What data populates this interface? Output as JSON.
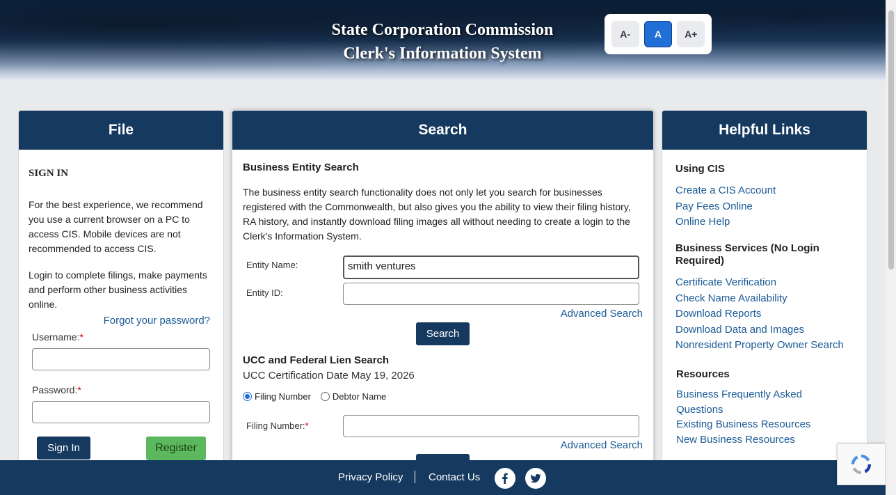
{
  "header": {
    "title_line1": "State Corporation Commission",
    "title_line2": "Clerk's Information System",
    "font_controls": [
      "A-",
      "A",
      "A+"
    ]
  },
  "file_panel": {
    "title": "File",
    "sign_in": "SIGN IN",
    "intro": "For the best experience, we recommend you use a current browser on a PC to access CIS. Mobile devices are not recommended to access CIS.",
    "login_text": "Login to complete filings, make payments and perform other business activities online.",
    "forgot_password": "Forgot your password?",
    "username_label": "Username:",
    "password_label": "Password:",
    "required_mark": "*",
    "sign_in_button": "Sign In",
    "register_button": "Register"
  },
  "search_panel": {
    "title": "Search",
    "business_heading": "Business Entity Search",
    "business_desc": "The business entity search functionality does not only let you search for businesses registered with the Commonwealth, but also gives you the ability to view their filing history, RA history, and instantly download filing images all without needing to create a login to the Clerk's Information System.",
    "entity_name_label": "Entity Name:",
    "entity_name_value": "smith ventures",
    "entity_id_label": "Entity ID:",
    "entity_id_value": "",
    "advanced_search": "Advanced Search",
    "search_button": "Search",
    "ucc_heading": "UCC and Federal Lien Search",
    "ucc_cert_date": "UCC Certification Date May 19, 2026",
    "radio_filing": "Filing Number",
    "radio_debtor": "Debtor Name",
    "filing_number_label": "Filing Number:",
    "filing_number_value": "",
    "advanced_search_2": "Advanced Search"
  },
  "links_panel": {
    "title": "Helpful Links",
    "using_cis": {
      "heading": "Using CIS",
      "links": [
        "Create a CIS Account",
        "Pay Fees Online",
        "Online Help"
      ]
    },
    "business_services": {
      "heading": "Business Services (No Login Required)",
      "links": [
        "Certificate Verification",
        "Check Name Availability",
        "Download Reports",
        "Download Data and Images",
        "Nonresident Property Owner Search"
      ]
    },
    "resources": {
      "heading": "Resources",
      "links": [
        "Business Frequently Asked Questions",
        "Existing Business Resources",
        "New Business Resources"
      ]
    }
  },
  "footer": {
    "privacy": "Privacy Policy",
    "contact": "Contact Us",
    "facebook_icon": "facebook-icon",
    "twitter_icon": "twitter-icon"
  }
}
